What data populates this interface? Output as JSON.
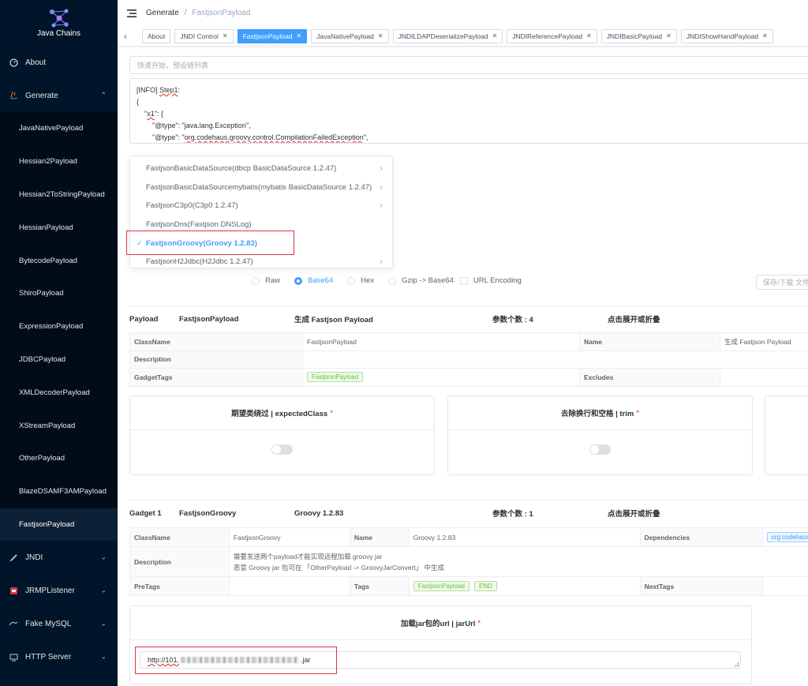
{
  "app": {
    "name": "Java Chains"
  },
  "sidebar": {
    "about": "About",
    "generate": "Generate",
    "sub_items": [
      "JavaNativePayload",
      "Hessian2Payload",
      "Hessian2ToStringPayload",
      "HessianPayload",
      "BytecodePayload",
      "ShiroPayload",
      "ExpressionPayload",
      "JDBCPayload",
      "XMLDecoderPayload",
      "XStreamPayload",
      "OtherPayload",
      "BlazeDSAMF3AMPayload",
      "FastjsonPayload"
    ],
    "jndi": "JNDI",
    "jrmp": "JRMPListener",
    "mysql": "Fake MySQL",
    "http": "HTTP Server"
  },
  "breadcrumb": {
    "first": "Generate",
    "sep": "/",
    "second": "FastjsonPayload"
  },
  "tabs": [
    {
      "label": "About",
      "closable": false
    },
    {
      "label": "JNDI Control",
      "closable": true
    },
    {
      "label": "FastjsonPayload",
      "closable": true,
      "active": true
    },
    {
      "label": "JavaNativePayload",
      "closable": true
    },
    {
      "label": "JNDILDAPDeserializePayload",
      "closable": true
    },
    {
      "label": "JNDIReferencePayload",
      "closable": true
    },
    {
      "label": "JNDIBasicPayload",
      "closable": true
    },
    {
      "label": "JNDIShowHandPayload",
      "closable": true
    }
  ],
  "preset": {
    "placeholder": "快速开始，预设链列表"
  },
  "code": {
    "line1a": "[INFO] ",
    "line1b": "Step1",
    "line1c": ":",
    "line2": "{",
    "line3a": "    \"",
    "line3b": "x1",
    "line3c": "\": {",
    "line4": "        \"@type\": \"java.lang.Exception\",",
    "line5a": "        \"@type\": \"",
    "line5b": "org.codehaus.groovy.control.CompilationFailedException",
    "line5c": "\","
  },
  "chain_options": [
    {
      "label": "FastjsonBasicDataSource(dbcp BasicDataSource 1.2.47)",
      "arrow": true
    },
    {
      "label": "FastjsonBasicDataSourcemybatis(mybatis BasicDataSource 1.2.47)",
      "arrow": true
    },
    {
      "label": "FastjsonC3p0(C3p0 1.2.47)",
      "arrow": true
    },
    {
      "label": "FastjsonDns(Fastjson DNSLog)",
      "arrow": false
    },
    {
      "label": "FastjsonGroovy(Groovy 1.2.83)",
      "arrow": false,
      "selected": true
    },
    {
      "label": "FastjsonH2Jdbc(H2Jdbc 1.2.47)",
      "arrow": true
    }
  ],
  "encoding": {
    "raw": "Raw",
    "base64": "Base64",
    "hex": "Hex",
    "gzip": "Gzip -> Base64",
    "url": "URL Encoding",
    "selected": "Base64"
  },
  "save": {
    "placeholder": "保存/下载 文件"
  },
  "payload_section": {
    "label": "Payload",
    "name": "FastjsonPayload",
    "desc": "生成 Fastjson Payload",
    "param_count": "参数个数 : 4",
    "toggle": "点击展开或折叠",
    "classname_label": "ClassName",
    "classname": "FastjsonPayload",
    "name_label": "Name",
    "name_value": "生成 Fastjson Payload",
    "description_label": "Description",
    "gadgettags_label": "GadgetTags",
    "gadgettag": "FastjsonPayload",
    "excludes_label": "Excludes"
  },
  "params": {
    "expected_class": "期望类绕过 | expectedClass",
    "trim": "去除换行和空格 | trim",
    "required_mark": "*"
  },
  "gadget_section": {
    "label": "Gadget 1",
    "name": "FastjsonGroovy",
    "desc": "Groovy 1.2.83",
    "param_count": "参数个数 : 1",
    "toggle": "点击展开或折叠",
    "classname_label": "ClassName",
    "classname": "FastjsonGroovy",
    "name_label": "Name",
    "name_value": "Groovy 1.2.83",
    "dependencies_label": "Dependencies",
    "dependency": "org.codehaus",
    "description_label": "Description",
    "description_line1": "需要发送两个payload才能实现远程加载 groovy jar",
    "description_line2": "恶意 Groovy jar 包可在 「OtherPayload -> GroovyJarConvert」 中生成",
    "pretags_label": "PreTags",
    "tags_label": "Tags",
    "tag1": "FastjsonPayload",
    "tag2": "END",
    "nexttags_label": "NextTags"
  },
  "jar_url": {
    "title": "加载jar包的url | jarUrl",
    "value_prefix": "http://101.",
    "value_suffix": ".jar"
  },
  "colors": {
    "sidebar_bg": "#001529",
    "accent": "#409eff",
    "highlight": "#d9363e",
    "tag_green": "#67c23a"
  }
}
